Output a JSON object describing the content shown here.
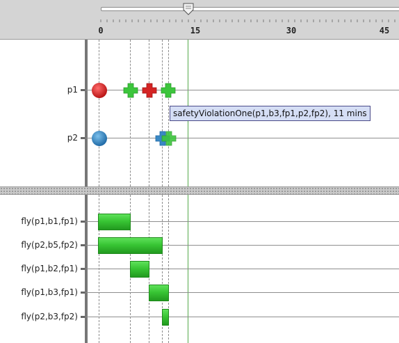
{
  "timeline": {
    "ruler_ticks": [
      "0",
      "15",
      "30",
      "45"
    ],
    "marker_rows": [
      {
        "label": "p1",
        "markers": [
          {
            "type": "circle",
            "color": "#d42424",
            "time": 0
          },
          {
            "type": "plus",
            "color": "#3cc53c",
            "time": 5
          },
          {
            "type": "plus",
            "color": "#d42424",
            "time": 8
          },
          {
            "type": "plus",
            "color": "#3cc53c",
            "time": 11
          }
        ]
      },
      {
        "label": "p2",
        "markers": [
          {
            "type": "circle",
            "color": "#3a88c4",
            "time": 0
          },
          {
            "type": "plus",
            "color": "#3a88c4",
            "time": 10
          },
          {
            "type": "plus",
            "color": "#3cc53c",
            "time": 11
          }
        ]
      }
    ],
    "tooltip": "safetyViolationOne(p1,b3,fp1,p2,fp2), 11 mins",
    "activity_rows": [
      {
        "label": "fly(p1,b1,fp1)",
        "start": 0,
        "end": 5
      },
      {
        "label": "fly(p2,b5,fp2)",
        "start": 0,
        "end": 10
      },
      {
        "label": "fly(p1,b2,fp1)",
        "start": 5,
        "end": 8
      },
      {
        "label": "fly(p1,b3,fp1)",
        "start": 8,
        "end": 11
      },
      {
        "label": "fly(p2,b3,fp2)",
        "start": 10,
        "end": 11
      }
    ]
  }
}
